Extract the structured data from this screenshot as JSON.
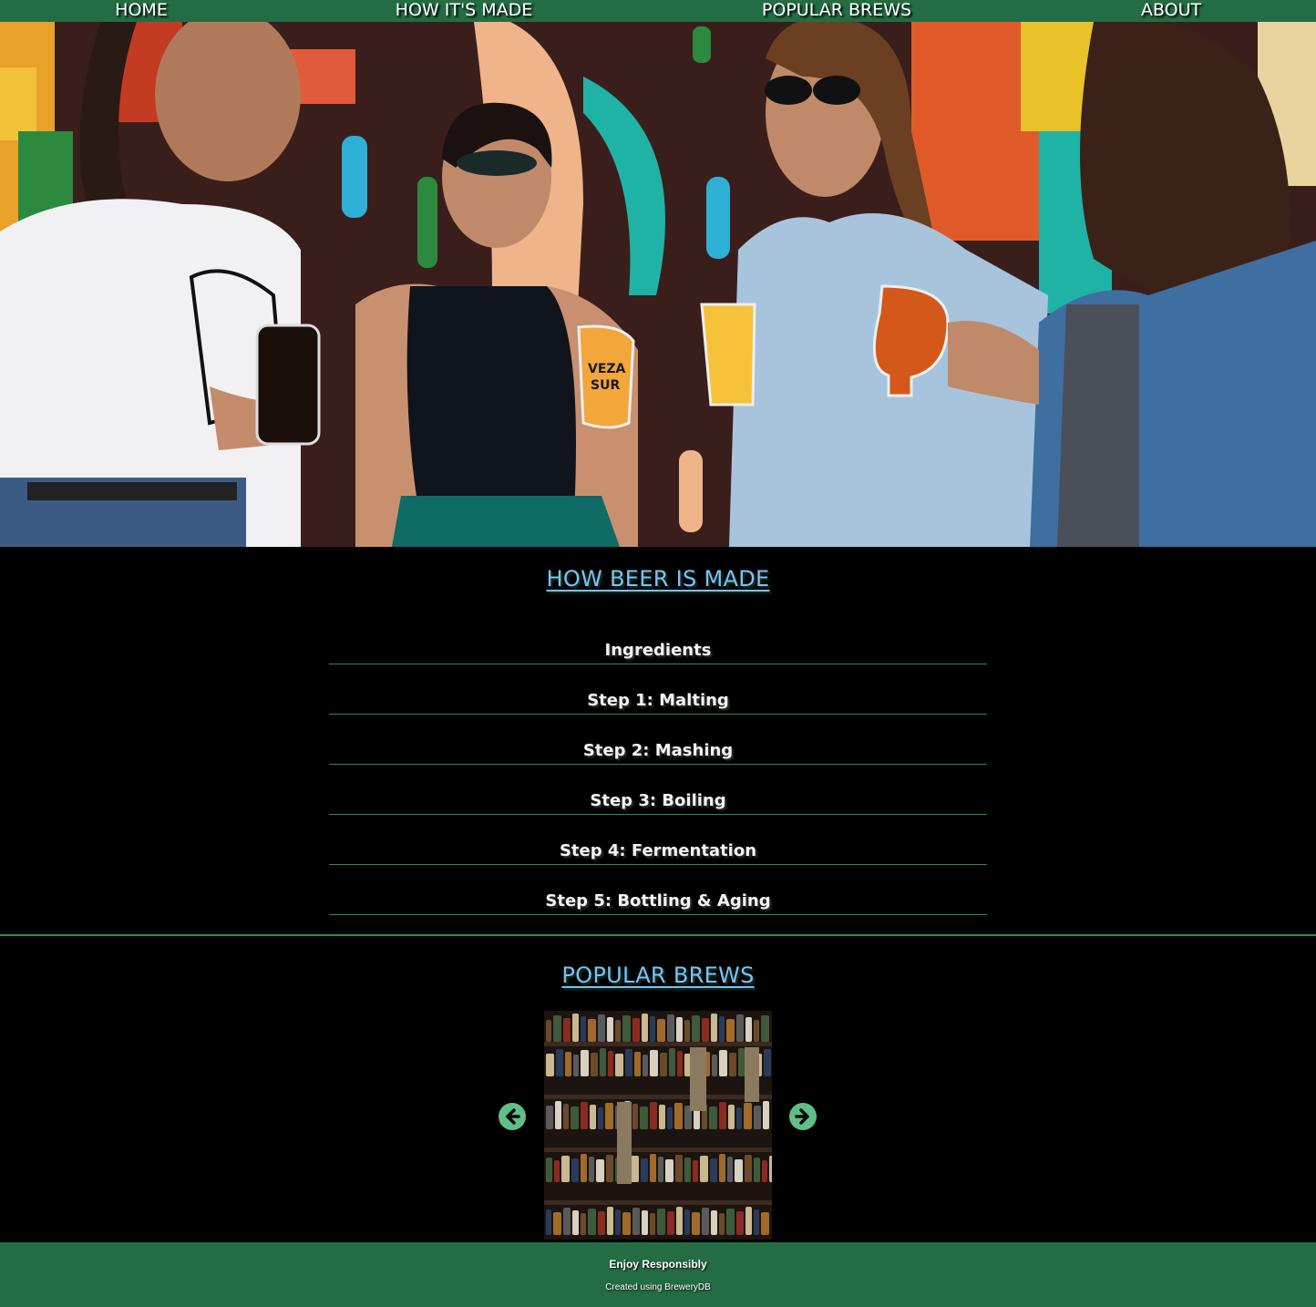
{
  "nav": {
    "home": "HOME",
    "how": "HOW IT'S MADE",
    "popular": "POPULAR BREWS",
    "about": "ABOUT"
  },
  "how_section": {
    "title": "HOW BEER IS MADE",
    "steps": [
      "Ingredients",
      "Step 1: Malting",
      "Step 2: Mashing",
      "Step 3: Boiling",
      "Step 4: Fermentation",
      "Step 5: Bottling & Aging"
    ]
  },
  "popular_section": {
    "title": "POPULAR BREWS"
  },
  "footer": {
    "enjoy": "Enjoy Responsibly",
    "created": "Created using BreweryDB"
  },
  "hero": {
    "glass_print": "VEZA SUR"
  },
  "colors": {
    "nav_bg": "#246c43",
    "heading": "#7cc1f5",
    "accent_line": "#2f8a55",
    "arrow": "#5fbf86",
    "page_bg": "#000000"
  }
}
